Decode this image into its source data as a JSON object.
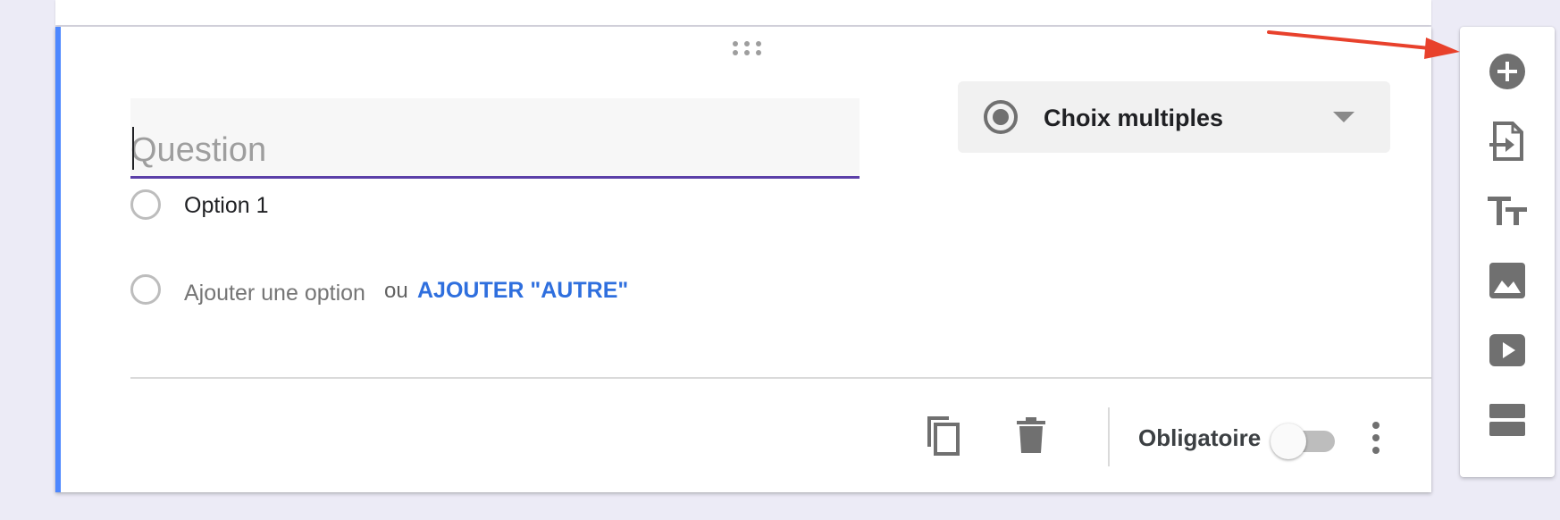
{
  "question": {
    "placeholder": "Question",
    "value": ""
  },
  "question_type": {
    "label": "Choix multiples",
    "icon": "radio-button-icon"
  },
  "options": [
    {
      "label": "Option 1"
    }
  ],
  "add_option": {
    "label": "Ajouter une option",
    "separator": "ou",
    "add_other_label": "AJOUTER \"AUTRE\""
  },
  "footer": {
    "required_label": "Obligatoire",
    "required_on": false,
    "copy_icon": "content-copy-icon",
    "delete_icon": "trash-icon",
    "more_icon": "more-vert-icon"
  },
  "toolbar": {
    "items": [
      {
        "icon": "add-circle-icon"
      },
      {
        "icon": "import-question-icon"
      },
      {
        "icon": "title-text-icon"
      },
      {
        "icon": "image-icon"
      },
      {
        "icon": "video-icon"
      },
      {
        "icon": "section-icon"
      }
    ]
  },
  "colors": {
    "accent": "#4d87ff",
    "underline": "#5b3fa8",
    "link": "#2f6fde",
    "annotation_arrow": "#e8412c",
    "icon": "#707070",
    "background": "#ecebf6"
  }
}
